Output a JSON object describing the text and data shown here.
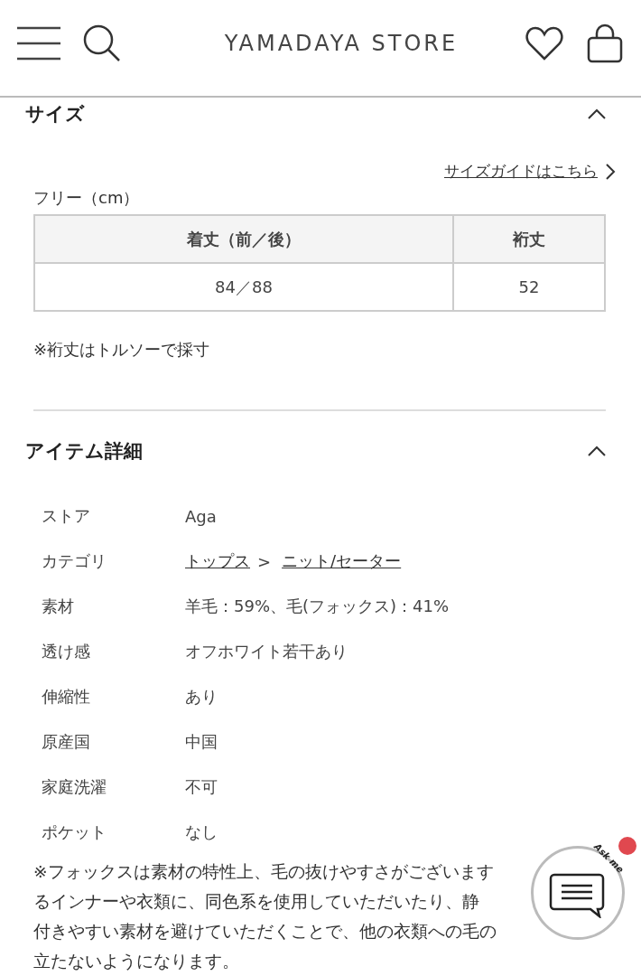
{
  "header": {
    "title": "YAMADAYA STORE"
  },
  "size_section": {
    "title": "サイズ",
    "expanded": true,
    "guide_link": "サイズガイドはこちら",
    "size_label": "フリー（cm）",
    "table": {
      "columns": [
        "着丈（前／後）",
        "裄丈"
      ],
      "rows": [
        [
          "84／88",
          "52"
        ]
      ]
    },
    "note": "※裄丈はトルソーで採寸"
  },
  "detail_section": {
    "title": "アイテム詳細",
    "expanded": true,
    "rows": [
      {
        "kind": "text",
        "label": "ストア",
        "value": "Aga"
      },
      {
        "kind": "links",
        "label": "カテゴリ",
        "links": [
          "トップス",
          "ニット/セーター"
        ],
        "separator": ">"
      },
      {
        "kind": "text",
        "label": "素材",
        "value": "羊毛：59%、毛(フォックス)：41%"
      },
      {
        "kind": "text",
        "label": "透け感",
        "value": "オフホワイト若干あり"
      },
      {
        "kind": "text",
        "label": "伸縮性",
        "value": "あり"
      },
      {
        "kind": "text",
        "label": "原産国",
        "value": "中国"
      },
      {
        "kind": "text",
        "label": "家庭洗濯",
        "value": "不可"
      },
      {
        "kind": "text",
        "label": "ポケット",
        "value": "なし"
      }
    ],
    "notice_lines": [
      "※フォックスは素材の特性上、毛の抜けやすさがございます",
      "るインナーや衣類に、同色系を使用していただいたり、静",
      "付きやすい素材を避けていただくことで、他の衣類への毛の",
      "立たないようになります。"
    ]
  },
  "chat_widget": {
    "caption": "Ask me",
    "unread": true
  }
}
